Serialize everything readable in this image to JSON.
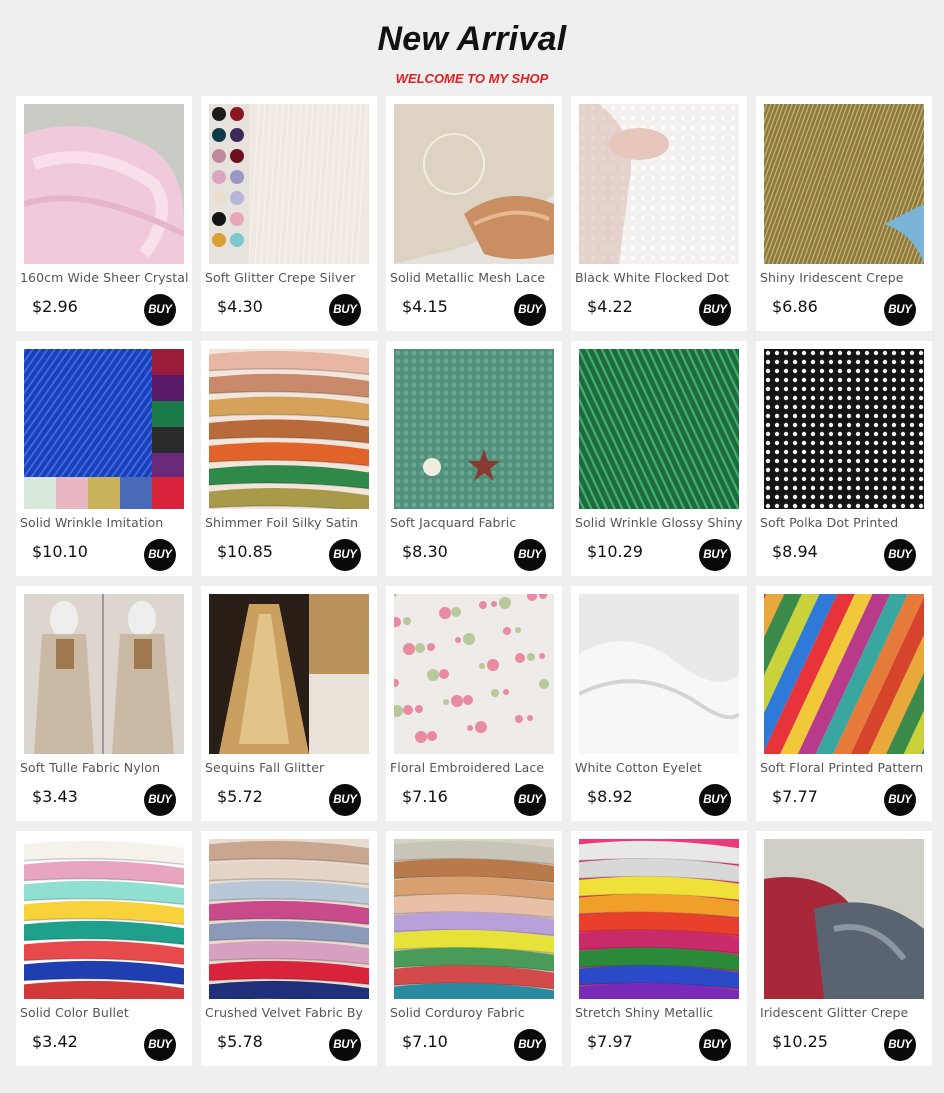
{
  "header": {
    "title": "New Arrival",
    "subtitle": "WELCOME TO MY SHOP"
  },
  "buy_label": "BUY",
  "products": [
    {
      "name": "160cm Wide Sheer Crystal",
      "price": "$2.96",
      "icon": "pink-tulle-fabric"
    },
    {
      "name": "Soft Glitter Crepe Silver",
      "price": "$4.30",
      "icon": "glitter-crepe-swatches"
    },
    {
      "name": "Solid Metallic Mesh Lace",
      "price": "$4.15",
      "icon": "metallic-mesh-lace"
    },
    {
      "name": "Black White Flocked Dot",
      "price": "$4.22",
      "icon": "flocked-dot-mesh"
    },
    {
      "name": "Shiny Iridescent Crepe",
      "price": "$6.86",
      "icon": "iridescent-crepe"
    },
    {
      "name": "Solid Wrinkle Imitation",
      "price": "$10.10",
      "icon": "blue-wrinkle-fabric"
    },
    {
      "name": "Shimmer Foil Silky Satin",
      "price": "$10.85",
      "icon": "foil-satin-stack"
    },
    {
      "name": "Soft Jacquard Fabric",
      "price": "$8.30",
      "icon": "green-jacquard"
    },
    {
      "name": "Solid Wrinkle Glossy Shiny",
      "price": "$10.29",
      "icon": "green-glossy-pleat"
    },
    {
      "name": "Soft Polka Dot Printed",
      "price": "$8.94",
      "icon": "polka-dot-fabric"
    },
    {
      "name": "Soft Tulle Fabric Nylon",
      "price": "$3.43",
      "icon": "tulle-on-mannequin"
    },
    {
      "name": "Sequins Fall Glitter",
      "price": "$5.72",
      "icon": "gold-sequin-dress"
    },
    {
      "name": "Floral Embroidered Lace",
      "price": "$7.16",
      "icon": "floral-lace"
    },
    {
      "name": "White Cotton Eyelet",
      "price": "$8.92",
      "icon": "white-eyelet"
    },
    {
      "name": "Soft Floral Printed Pattern",
      "price": "$7.77",
      "icon": "striped-floral-print"
    },
    {
      "name": "Solid Color Bullet",
      "price": "$3.42",
      "icon": "color-bullet-stack"
    },
    {
      "name": "Crushed Velvet Fabric By",
      "price": "$5.78",
      "icon": "crushed-velvet-stack"
    },
    {
      "name": "Solid Corduroy Fabric",
      "price": "$7.10",
      "icon": "corduroy-stack"
    },
    {
      "name": "Stretch Shiny Metallic",
      "price": "$7.97",
      "icon": "metallic-rainbow-stack"
    },
    {
      "name": "Iridescent Glitter Crepe",
      "price": "$10.25",
      "icon": "iridescent-glitter-crepe"
    }
  ]
}
